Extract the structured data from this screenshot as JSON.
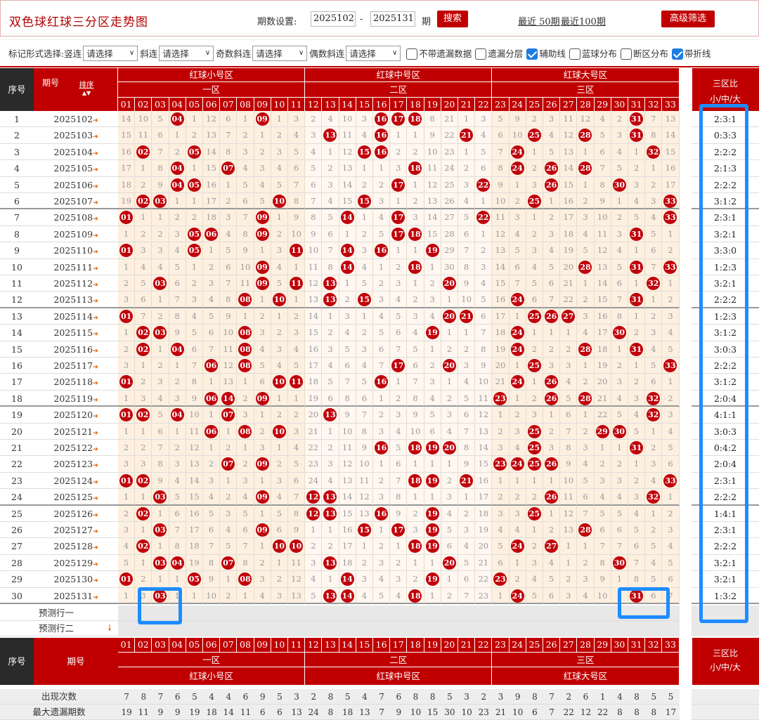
{
  "header": {
    "title": "双色球红球三分区走势图",
    "period_setting_label": "期数设置:",
    "period_from": "2025102",
    "dash": "-",
    "period_to": "2025131",
    "period_unit": "期",
    "search_label": "搜索",
    "recent50_label": "最近 50期",
    "recent100_label": "最近100期",
    "advanced_filter_label": "高级筛选"
  },
  "options": {
    "mark_style_label": "标记形式选择:",
    "vertical_label": "竖连",
    "select_placeholder": "请选择",
    "diagonal_label": "斜连",
    "odd_diagonal_label": "奇数斜连",
    "even_diagonal_label": "偶数斜连",
    "checkboxes": [
      {
        "label": "不带遗漏数据",
        "checked": false
      },
      {
        "label": "遗漏分层",
        "checked": false
      },
      {
        "label": "辅助线",
        "checked": true
      },
      {
        "label": "蓝球分布",
        "checked": false
      },
      {
        "label": "断区分布",
        "checked": false
      },
      {
        "label": "带折线",
        "checked": true
      }
    ]
  },
  "table": {
    "col_seq": "序号",
    "col_period": "期号",
    "sort_label": "排序",
    "zone_groups": [
      "红球小号区",
      "红球中号区",
      "红球大号区"
    ],
    "zones": [
      "一区",
      "二区",
      "三区"
    ],
    "ratio_header": "三区比",
    "ratio_sub": "小/中/大",
    "numbers": [
      "01",
      "02",
      "03",
      "04",
      "05",
      "06",
      "07",
      "08",
      "09",
      "10",
      "11",
      "12",
      "13",
      "14",
      "15",
      "16",
      "17",
      "18",
      "19",
      "20",
      "21",
      "22",
      "23",
      "24",
      "25",
      "26",
      "27",
      "28",
      "29",
      "30",
      "31",
      "32",
      "33"
    ],
    "rows": [
      {
        "seq": "1",
        "period": "2025102",
        "cells": [
          14,
          10,
          5,
          "04",
          1,
          12,
          6,
          1,
          "09",
          1,
          3,
          2,
          4,
          10,
          3,
          "16",
          "17",
          "18",
          8,
          21,
          1,
          3,
          5,
          9,
          2,
          3,
          11,
          12,
          4,
          2,
          "31",
          7,
          13
        ],
        "ratio": "2:3:1"
      },
      {
        "seq": "2",
        "period": "2025103",
        "cells": [
          15,
          11,
          6,
          1,
          2,
          13,
          7,
          2,
          1,
          2,
          4,
          3,
          "13",
          11,
          4,
          "16",
          1,
          1,
          9,
          22,
          "21",
          4,
          6,
          10,
          "25",
          4,
          12,
          "28",
          5,
          3,
          "31",
          8,
          14
        ],
        "ratio": "0:3:3"
      },
      {
        "seq": "3",
        "period": "2025104",
        "cells": [
          16,
          "02",
          7,
          2,
          "05",
          14,
          8,
          3,
          2,
          3,
          5,
          4,
          1,
          12,
          "15",
          "16",
          2,
          2,
          10,
          23,
          1,
          5,
          7,
          "24",
          1,
          5,
          13,
          1,
          6,
          4,
          1,
          "32",
          15
        ],
        "ratio": "2:2:2"
      },
      {
        "seq": "4",
        "period": "2025105",
        "cells": [
          17,
          1,
          8,
          "04",
          1,
          15,
          "07",
          4,
          3,
          4,
          6,
          5,
          2,
          13,
          1,
          1,
          3,
          "18",
          11,
          24,
          2,
          6,
          8,
          "24",
          2,
          "26",
          14,
          "28",
          7,
          5,
          2,
          1,
          16
        ],
        "ratio": "2:1:3"
      },
      {
        "seq": "5",
        "period": "2025106",
        "cells": [
          18,
          2,
          9,
          "04",
          "05",
          16,
          1,
          5,
          4,
          5,
          7,
          6,
          3,
          14,
          2,
          2,
          "17",
          1,
          12,
          25,
          3,
          "22",
          9,
          1,
          3,
          "26",
          15,
          1,
          8,
          "30",
          3,
          2,
          17
        ],
        "ratio": "2:2:2"
      },
      {
        "seq": "6",
        "period": "2025107",
        "cells": [
          19,
          "02",
          "03",
          1,
          1,
          17,
          2,
          6,
          5,
          "10",
          8,
          7,
          4,
          15,
          "15",
          3,
          1,
          2,
          13,
          26,
          4,
          1,
          10,
          2,
          "25",
          1,
          16,
          2,
          9,
          1,
          4,
          3,
          "33"
        ],
        "ratio": "3:1:2"
      },
      {
        "seq": "7",
        "period": "2025108",
        "cells": [
          "01",
          1,
          1,
          2,
          2,
          18,
          3,
          7,
          "09",
          1,
          9,
          8,
          5,
          "14",
          1,
          4,
          "17",
          3,
          14,
          27,
          5,
          "22",
          11,
          3,
          1,
          2,
          17,
          3,
          10,
          2,
          5,
          4,
          "33"
        ],
        "ratio": "2:3:1"
      },
      {
        "seq": "8",
        "period": "2025109",
        "cells": [
          1,
          2,
          2,
          3,
          "05",
          "06",
          4,
          8,
          "09",
          2,
          10,
          9,
          6,
          1,
          2,
          5,
          "17",
          "18",
          15,
          28,
          6,
          1,
          12,
          4,
          2,
          3,
          18,
          4,
          11,
          3,
          "31",
          5,
          1
        ],
        "ratio": "3:2:1"
      },
      {
        "seq": "9",
        "period": "2025110",
        "cells": [
          "01",
          3,
          3,
          4,
          "05",
          1,
          5,
          9,
          1,
          3,
          "11",
          10,
          7,
          "14",
          3,
          "16",
          1,
          1,
          "19",
          29,
          7,
          2,
          13,
          5,
          3,
          4,
          19,
          5,
          12,
          4,
          1,
          6,
          2
        ],
        "ratio": "3:3:0"
      },
      {
        "seq": "10",
        "period": "2025111",
        "cells": [
          1,
          4,
          4,
          5,
          1,
          2,
          6,
          10,
          "09",
          4,
          1,
          11,
          8,
          "14",
          4,
          1,
          2,
          "18",
          1,
          30,
          8,
          3,
          14,
          6,
          4,
          5,
          20,
          "28",
          13,
          5,
          "31",
          7,
          "33"
        ],
        "ratio": "1:2:3"
      },
      {
        "seq": "11",
        "period": "2025112",
        "cells": [
          2,
          5,
          "03",
          6,
          2,
          3,
          7,
          11,
          "09",
          5,
          "11",
          12,
          "13",
          1,
          5,
          2,
          3,
          1,
          2,
          "20",
          9,
          4,
          15,
          7,
          5,
          6,
          21,
          1,
          14,
          6,
          1,
          "32",
          1
        ],
        "ratio": "3:2:1"
      },
      {
        "seq": "12",
        "period": "2025113",
        "cells": [
          3,
          6,
          1,
          7,
          3,
          4,
          8,
          "08",
          1,
          "10",
          1,
          13,
          "13",
          2,
          "15",
          3,
          4,
          2,
          3,
          1,
          10,
          5,
          16,
          "24",
          6,
          7,
          22,
          2,
          15,
          7,
          "31",
          1,
          2
        ],
        "ratio": "2:2:2"
      },
      {
        "seq": "13",
        "period": "2025114",
        "cells": [
          "01",
          7,
          2,
          8,
          4,
          5,
          9,
          1,
          2,
          1,
          2,
          14,
          1,
          3,
          1,
          4,
          5,
          3,
          4,
          "20",
          "21",
          6,
          17,
          1,
          "25",
          "26",
          "27",
          3,
          16,
          8,
          1,
          2,
          3
        ],
        "ratio": "1:2:3"
      },
      {
        "seq": "14",
        "period": "2025115",
        "cells": [
          1,
          "02",
          "03",
          9,
          5,
          6,
          10,
          "08",
          3,
          2,
          3,
          15,
          2,
          4,
          2,
          5,
          6,
          4,
          "19",
          1,
          1,
          7,
          18,
          "24",
          1,
          1,
          1,
          4,
          17,
          "30",
          2,
          3,
          4
        ],
        "ratio": "3:1:2"
      },
      {
        "seq": "15",
        "period": "2025116",
        "cells": [
          2,
          "02",
          1,
          "04",
          6,
          7,
          11,
          "08",
          4,
          3,
          4,
          16,
          3,
          5,
          3,
          6,
          7,
          5,
          1,
          2,
          2,
          8,
          19,
          "24",
          2,
          2,
          2,
          "28",
          18,
          1,
          "31",
          4,
          5
        ],
        "ratio": "3:0:3"
      },
      {
        "seq": "16",
        "period": "2025117",
        "cells": [
          3,
          1,
          2,
          1,
          7,
          "06",
          12,
          "08",
          5,
          4,
          5,
          17,
          4,
          6,
          4,
          7,
          "17",
          6,
          2,
          "20",
          3,
          9,
          20,
          1,
          "25",
          3,
          3,
          1,
          19,
          2,
          1,
          5,
          "33"
        ],
        "ratio": "2:2:2"
      },
      {
        "seq": "17",
        "period": "2025118",
        "cells": [
          "01",
          2,
          3,
          2,
          8,
          1,
          13,
          1,
          6,
          "10",
          "11",
          18,
          5,
          7,
          5,
          "16",
          1,
          7,
          3,
          1,
          4,
          10,
          21,
          "24",
          1,
          "26",
          4,
          2,
          20,
          3,
          2,
          6,
          1
        ],
        "ratio": "3:1:2"
      },
      {
        "seq": "18",
        "period": "2025119",
        "cells": [
          1,
          3,
          4,
          3,
          9,
          "06",
          "14",
          2,
          "09",
          1,
          1,
          19,
          6,
          8,
          6,
          1,
          2,
          8,
          4,
          2,
          5,
          11,
          "23",
          1,
          2,
          "26",
          5,
          "28",
          21,
          4,
          3,
          "32",
          2
        ],
        "ratio": "2:0:4"
      },
      {
        "seq": "19",
        "period": "2025120",
        "cells": [
          "01",
          "02",
          5,
          "04",
          10,
          1,
          "07",
          3,
          1,
          2,
          2,
          20,
          "13",
          9,
          7,
          2,
          3,
          9,
          5,
          3,
          6,
          12,
          1,
          2,
          3,
          1,
          6,
          1,
          22,
          5,
          4,
          "32",
          3
        ],
        "ratio": "4:1:1"
      },
      {
        "seq": "20",
        "period": "2025121",
        "cells": [
          1,
          1,
          6,
          1,
          11,
          "06",
          1,
          "08",
          2,
          "10",
          3,
          21,
          1,
          10,
          8,
          3,
          4,
          10,
          6,
          4,
          7,
          13,
          2,
          3,
          "25",
          2,
          7,
          2,
          "29",
          "30",
          5,
          1,
          4
        ],
        "ratio": "3:0:3"
      },
      {
        "seq": "21",
        "period": "2025122",
        "cells": [
          2,
          2,
          7,
          2,
          12,
          1,
          2,
          1,
          3,
          1,
          4,
          22,
          2,
          11,
          9,
          "16",
          5,
          "18",
          "19",
          "20",
          8,
          14,
          3,
          4,
          "25",
          3,
          8,
          3,
          1,
          1,
          "31",
          2,
          5
        ],
        "ratio": "0:4:2"
      },
      {
        "seq": "22",
        "period": "2025123",
        "cells": [
          3,
          3,
          8,
          3,
          13,
          2,
          "07",
          2,
          "09",
          2,
          5,
          23,
          3,
          12,
          10,
          1,
          6,
          1,
          1,
          1,
          9,
          15,
          "23",
          "24",
          "25",
          "26",
          9,
          4,
          2,
          2,
          1,
          3,
          6
        ],
        "ratio": "2:0:4"
      },
      {
        "seq": "23",
        "period": "2025124",
        "cells": [
          "01",
          "02",
          9,
          4,
          14,
          3,
          1,
          3,
          1,
          3,
          6,
          24,
          4,
          13,
          11,
          2,
          7,
          "18",
          "19",
          2,
          "21",
          16,
          1,
          1,
          1,
          1,
          10,
          5,
          3,
          3,
          2,
          4,
          "33"
        ],
        "ratio": "2:3:1"
      },
      {
        "seq": "24",
        "period": "2025125",
        "cells": [
          1,
          1,
          "03",
          5,
          15,
          4,
          2,
          4,
          "09",
          4,
          7,
          "12",
          "13",
          14,
          12,
          3,
          8,
          1,
          1,
          3,
          1,
          17,
          2,
          2,
          2,
          "26",
          11,
          6,
          4,
          4,
          3,
          "32",
          1
        ],
        "ratio": "2:2:2"
      },
      {
        "seq": "25",
        "period": "2025126",
        "cells": [
          2,
          "02",
          1,
          6,
          16,
          5,
          3,
          5,
          1,
          5,
          8,
          "12",
          "13",
          15,
          13,
          "16",
          9,
          2,
          "19",
          4,
          2,
          18,
          3,
          3,
          "25",
          1,
          12,
          7,
          5,
          5,
          4,
          1,
          2
        ],
        "ratio": "1:4:1"
      },
      {
        "seq": "26",
        "period": "2025127",
        "cells": [
          3,
          1,
          "03",
          7,
          17,
          6,
          4,
          6,
          "09",
          6,
          9,
          1,
          1,
          16,
          "15",
          1,
          "17",
          3,
          "19",
          5,
          3,
          19,
          4,
          4,
          1,
          2,
          13,
          "28",
          6,
          6,
          5,
          2,
          3
        ],
        "ratio": "2:3:1"
      },
      {
        "seq": "27",
        "period": "2025128",
        "cells": [
          4,
          "02",
          1,
          8,
          18,
          7,
          5,
          7,
          1,
          "10",
          "10",
          2,
          2,
          17,
          1,
          2,
          1,
          "18",
          "19",
          6,
          4,
          20,
          5,
          "24",
          2,
          "27",
          1,
          1,
          7,
          7,
          6,
          5,
          4
        ],
        "ratio": "2:2:2"
      },
      {
        "seq": "28",
        "period": "2025129",
        "cells": [
          5,
          1,
          "03",
          "04",
          19,
          8,
          "07",
          8,
          2,
          1,
          11,
          3,
          "13",
          18,
          2,
          3,
          2,
          1,
          1,
          "20",
          5,
          21,
          6,
          1,
          3,
          4,
          1,
          2,
          8,
          "30",
          7,
          4,
          5
        ],
        "ratio": "3:2:1"
      },
      {
        "seq": "29",
        "period": "2025130",
        "cells": [
          "01",
          2,
          1,
          1,
          "05",
          9,
          1,
          "08",
          3,
          2,
          12,
          4,
          1,
          "14",
          3,
          4,
          3,
          2,
          "19",
          1,
          6,
          22,
          "23",
          2,
          4,
          5,
          2,
          3,
          9,
          1,
          8,
          5,
          6
        ],
        "ratio": "3:2:1"
      },
      {
        "seq": "30",
        "period": "2025131",
        "cells": [
          1,
          3,
          "03",
          1,
          1,
          10,
          2,
          1,
          4,
          3,
          13,
          5,
          "13",
          "14",
          4,
          5,
          4,
          "18",
          1,
          2,
          7,
          23,
          1,
          "24",
          5,
          6,
          3,
          4,
          10,
          2,
          "31",
          6,
          7
        ],
        "ratio": "1:3:2"
      }
    ],
    "predict_rows": [
      "预测行一",
      "预测行二"
    ],
    "stats": [
      {
        "label": "出现次数",
        "values": [
          7,
          8,
          7,
          6,
          5,
          4,
          4,
          6,
          9,
          5,
          3,
          2,
          8,
          5,
          4,
          7,
          6,
          8,
          8,
          5,
          3,
          2,
          3,
          9,
          8,
          7,
          2,
          6,
          1,
          4,
          8,
          5,
          5
        ]
      },
      {
        "label": "最大遗漏期数",
        "values": [
          19,
          11,
          9,
          9,
          19,
          18,
          14,
          11,
          6,
          6,
          13,
          24,
          8,
          18,
          13,
          7,
          9,
          10,
          15,
          30,
          10,
          23,
          21,
          10,
          6,
          7,
          22,
          12,
          22,
          8,
          8,
          8,
          17
        ]
      }
    ]
  }
}
